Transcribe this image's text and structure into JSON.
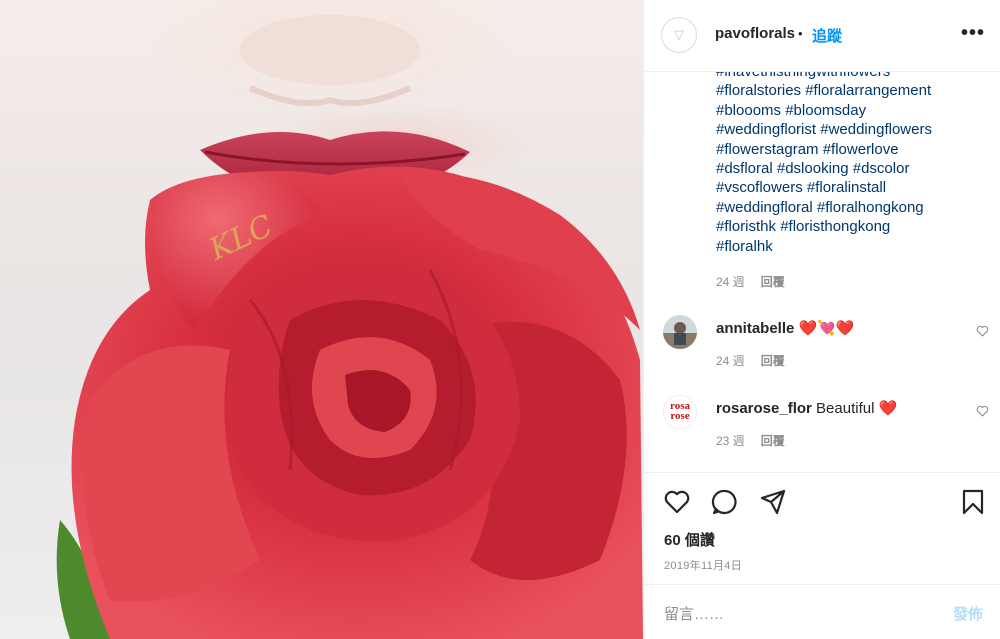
{
  "post": {
    "username": "pavoflorals",
    "separator": "•",
    "follow_label": "追蹤",
    "more_label": "•••",
    "photo_overlay_text": "KLC"
  },
  "caption": {
    "lines": [
      "#ihavethisthingwithflowers",
      "#floralstories #floralarrangement",
      "#bloooms #bloomsday",
      "#weddingflorist #weddingflowers",
      "#flowerstagram #flowerlove",
      "#dsfloral #dslooking #dscolor",
      "#vscoflowers #floralinstall",
      "#weddingfloral #floralhongkong",
      "#floristhk #floristhongkong",
      "#floralhk"
    ],
    "time": "24 週",
    "reply_label": "回覆"
  },
  "comments": [
    {
      "username": "annitabelle",
      "text": "❤️💘❤️",
      "time": "24 週",
      "reply_label": "回覆"
    },
    {
      "username": "rosarose_flor",
      "text": "Beautiful ❤️",
      "time": "23 週",
      "reply_label": "回覆",
      "avatar_text_1": "rosa",
      "avatar_text_2": "rose"
    }
  ],
  "footer": {
    "likes": "60 個讚",
    "date": "2019年11月4日",
    "comment_placeholder": "留言……",
    "post_label": "發佈"
  },
  "colors": {
    "link": "#00376b",
    "follow": "#0095f6",
    "muted": "#8e8e8e",
    "post_disabled": "#b2dffc",
    "rose": "#d9343f"
  }
}
